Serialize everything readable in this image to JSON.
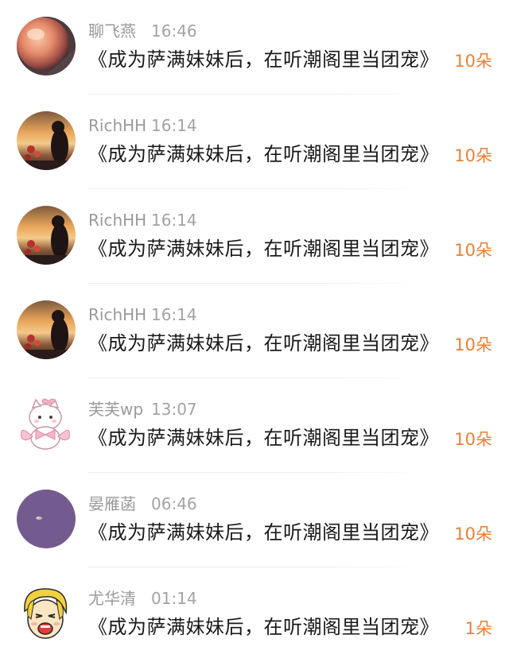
{
  "gifts": [
    {
      "user": "聊飞燕",
      "time": "16:46",
      "message": "《成为萨满妹妹后，在听潮阁里当团宠》",
      "count": "10朵",
      "avatar": "peach-sphere-photo"
    },
    {
      "user": "RichHH",
      "time": "16:14",
      "message": "《成为萨满妹妹后，在听潮阁里当团宠》",
      "count": "10朵",
      "avatar": "sunset-girl-photo"
    },
    {
      "user": "RichHH",
      "time": "16:14",
      "message": "《成为萨满妹妹后，在听潮阁里当团宠》",
      "count": "10朵",
      "avatar": "sunset-girl-photo"
    },
    {
      "user": "RichHH",
      "time": "16:14",
      "message": "《成为萨满妹妹后，在听潮阁里当团宠》",
      "count": "10朵",
      "avatar": "sunset-girl-photo"
    },
    {
      "user": "芙芙wp",
      "time": "13:07",
      "message": "《成为萨满妹妹后，在听潮阁里当团宠》",
      "count": "10朵",
      "avatar": "pink-bow-cat-illustration"
    },
    {
      "user": "晏雁菡",
      "time": "06:46",
      "message": "《成为萨满妹妹后，在听潮阁里当团宠》",
      "count": "10朵",
      "avatar": "purple-circle-avatar"
    },
    {
      "user": "尤华清",
      "time": "01:14",
      "message": "《成为萨满妹妹后，在听潮阁里当团宠》",
      "count": "1朵",
      "avatar": "blonde-cartoon-face"
    }
  ],
  "colors": {
    "count": "#ea7f36",
    "username": "#9a9a9a",
    "message": "#1a1a1a",
    "divider": "#eeeeee",
    "purple_avatar": "#735b8f"
  }
}
